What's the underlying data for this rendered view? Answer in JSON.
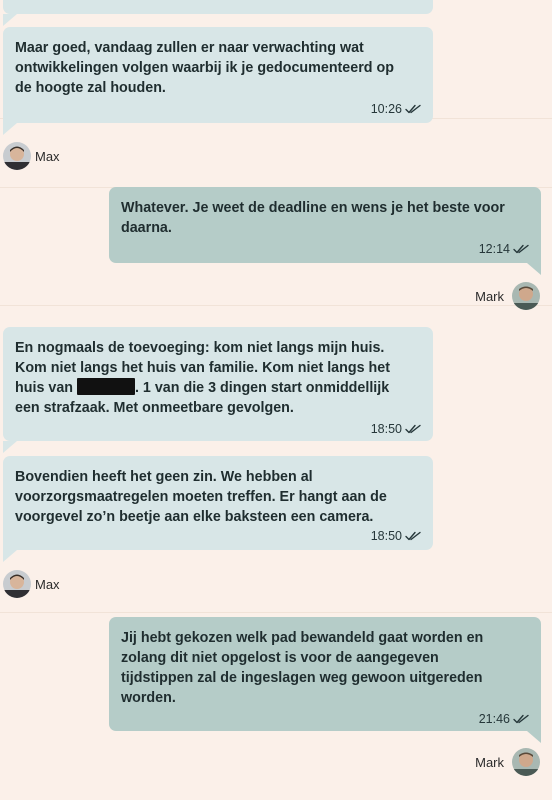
{
  "colors": {
    "background": "#fbf0e9",
    "incoming_bubble": "#d8e6e7",
    "outgoing_bubble": "#b5ccc8",
    "tick_color": "#26373a"
  },
  "messages": [
    {
      "direction": "in",
      "text": "Maar goed, vandaag zullen er naar verwachting wat ontwikkelingen volgen waarbij ik je gedocumenteerd op de hoogte zal houden.",
      "time": "10:26"
    },
    {
      "direction": "out",
      "text": "Whatever. Je weet de deadline en wens je het beste voor daarna.",
      "time": "12:14"
    },
    {
      "direction": "in",
      "text_before": "En nogmaals de toevoeging: kom niet langs mijn huis. Kom niet langs het huis van familie. Kom niet langs het huis van ",
      "text_after": ". 1 van die 3 dingen start onmiddellijk een strafzaak. Met onmeetbare gevolgen.",
      "time": "18:50"
    },
    {
      "direction": "in",
      "text": "Bovendien heeft het geen zin. We hebben al voorzorgsmaatregelen moeten treffen. Er hangt aan de voorgevel zo’n beetje aan elke baksteen een camera.",
      "time": "18:50"
    },
    {
      "direction": "out",
      "text": "Jij hebt gekozen welk pad bewandeld gaat worden en zolang dit niet opgelost is voor de aangegeven tijdstippen zal de ingeslagen weg gewoon uitgereden worden.",
      "time": "21:46"
    }
  ],
  "senders": {
    "max": "Max",
    "mark": "Mark"
  }
}
